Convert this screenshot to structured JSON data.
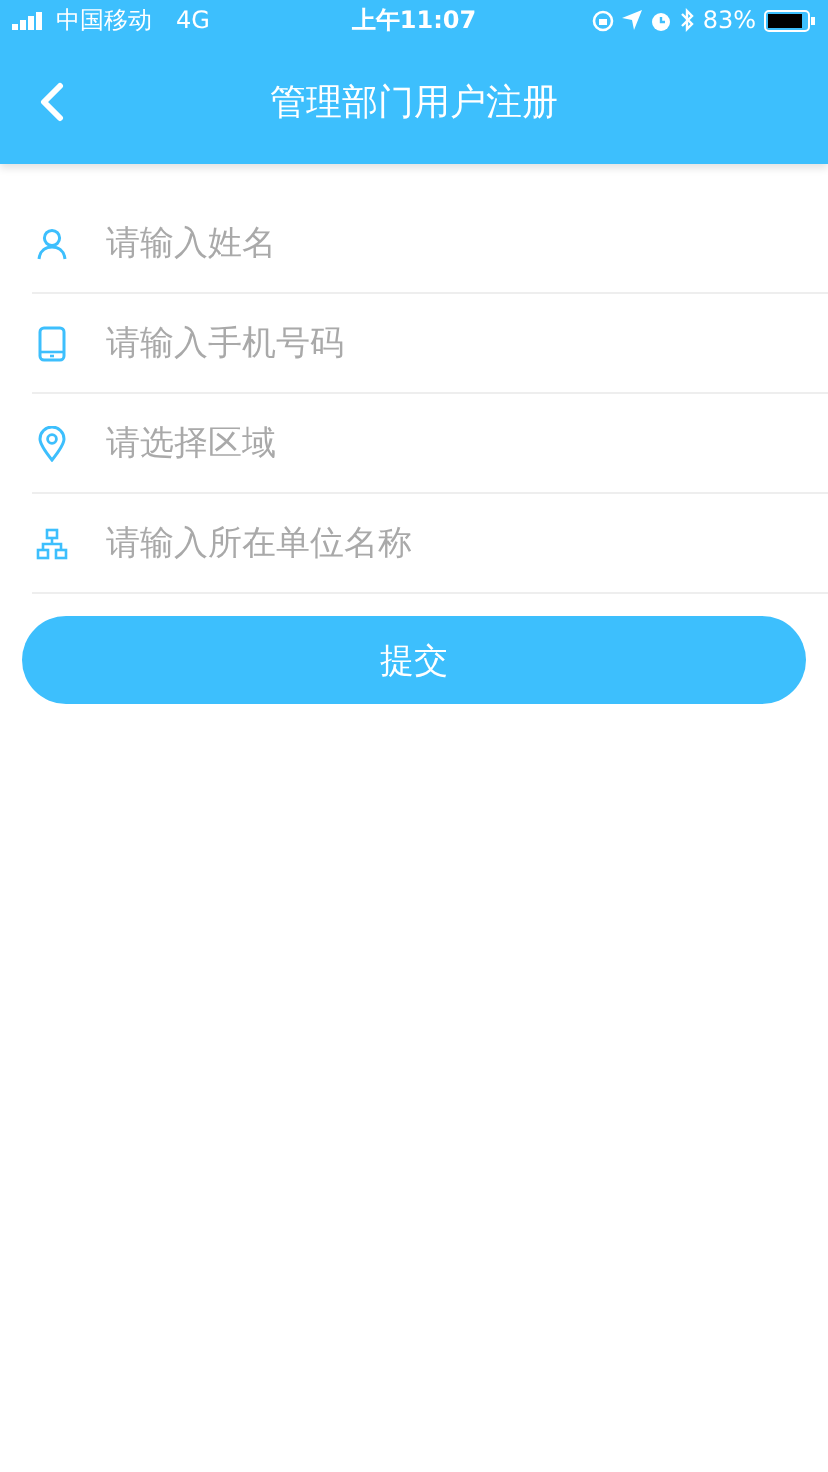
{
  "status_bar": {
    "carrier": "中国移动",
    "network": "4G",
    "time": "上午11:07",
    "battery": "83%"
  },
  "nav": {
    "title": "管理部门用户注册"
  },
  "fields": [
    {
      "kind": "person",
      "placeholder": "请输入姓名"
    },
    {
      "kind": "phone",
      "placeholder": "请输入手机号码"
    },
    {
      "kind": "location",
      "placeholder": "请选择区域"
    },
    {
      "kind": "org",
      "placeholder": "请输入所在单位名称"
    }
  ],
  "submit": "提交"
}
